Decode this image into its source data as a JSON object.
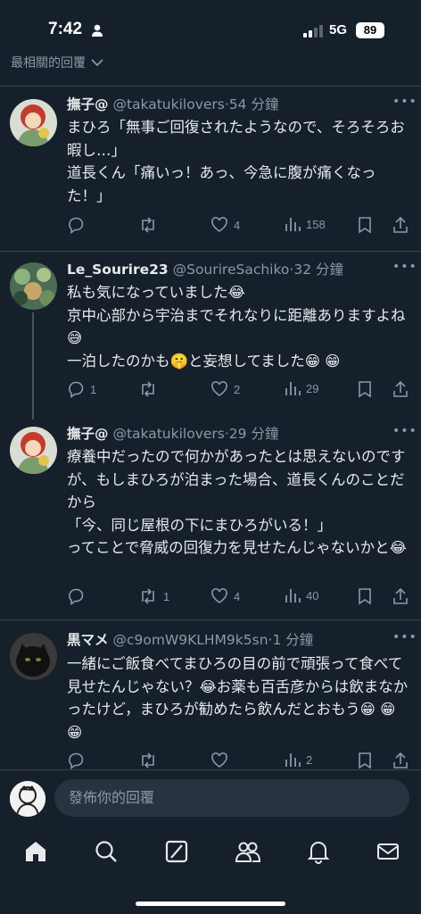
{
  "status_bar": {
    "time": "7:42",
    "network": "5G",
    "battery": "89"
  },
  "sort_label": "最相關的回覆",
  "tweets": [
    {
      "name": "撫子@",
      "handle": "@takatukilovers",
      "time": "·54 分鐘",
      "text": "まひろ「無事ご回復されたようなので、そろそろお暇し…」\n道長くん「痛いっ！あっ、今急に腹が痛くなった！」",
      "replies": "",
      "reposts": "",
      "likes": "4",
      "views": "158"
    },
    {
      "name": "Le_Sourire23",
      "handle": "@SourireSachiko",
      "time": "·32 分鐘",
      "text": "私も気になっていました😂\n京中心部から宇治までそれなりに距離ありますよね😅\n一泊したのかも🤫と妄想してました😁 😁",
      "replies": "1",
      "reposts": "",
      "likes": "2",
      "views": "29"
    },
    {
      "name": "撫子@",
      "handle": "@takatukilovers",
      "time": "·29 分鐘",
      "text": "療養中だったので何かがあったとは思えないのですが、もしまひろが泊まった場合、道長くんのことだから\n「今、同じ屋根の下にまひろがいる！」\nってことで脅威の回復力を見せたんじゃないかと😂",
      "replies": "",
      "reposts": "1",
      "likes": "4",
      "views": "40"
    },
    {
      "name": "黒マメ",
      "handle": "@c9omW9KLHM9k5sn",
      "time": "·1 分鐘",
      "text": "一緒にご飯食べてまひろの目の前で頑張って食べて見せたんじゃない？😂お薬も百舌彦からは飲まなかったけど，まひろが勧めたら飲んだとおもう😁 😁 😁",
      "replies": "",
      "reposts": "",
      "likes": "",
      "views": "2"
    }
  ],
  "reply_bar": {
    "placeholder": "發佈你的回覆"
  },
  "tab_bar": [
    "home-icon",
    "search-icon",
    "grok-icon",
    "communities-icon",
    "notifications-icon",
    "messages-icon"
  ],
  "colors": {
    "background": "#15202b",
    "text": "#e7e9ea",
    "secondary": "#8b98a5",
    "divider": "#38444d"
  }
}
